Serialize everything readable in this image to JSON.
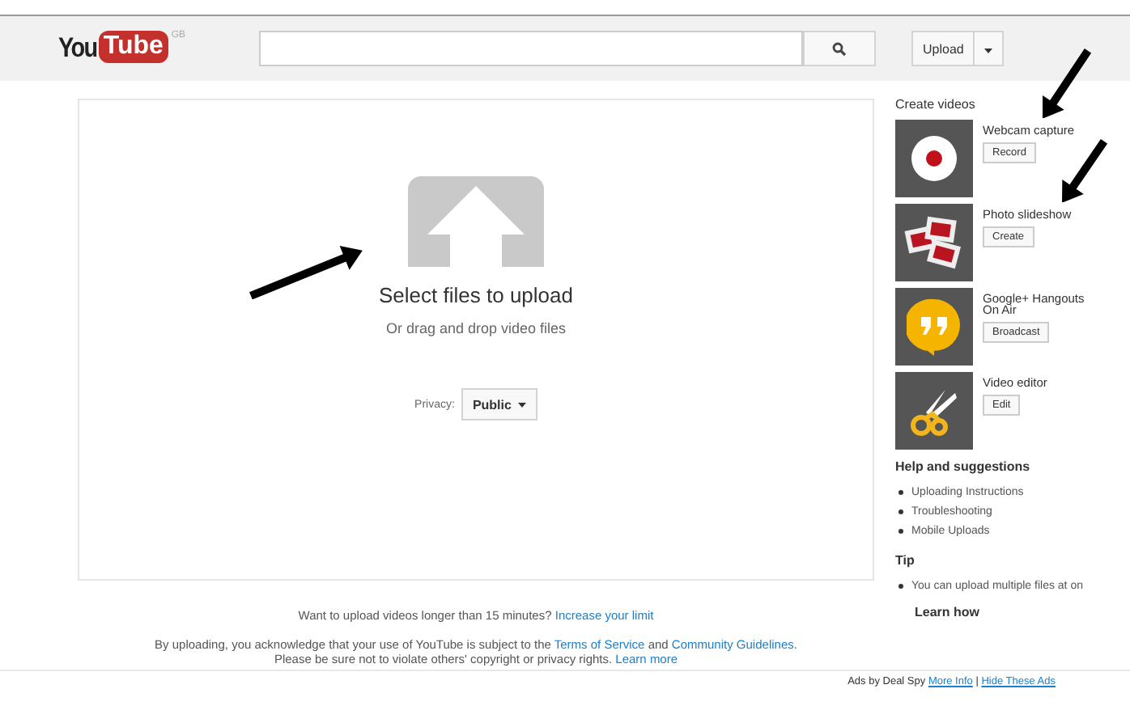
{
  "header": {
    "logo": {
      "you": "You",
      "tube": "Tube",
      "region": "GB"
    },
    "upload_button": "Upload"
  },
  "upload": {
    "title": "Select files to upload",
    "subtitle": "Or drag and drop video files",
    "privacy_label": "Privacy:",
    "privacy_value": "Public"
  },
  "limit_note": {
    "text": "Want to upload videos longer than 15 minutes? ",
    "link": "Increase your limit"
  },
  "terms": [
    [
      {
        "kind": "text",
        "text": "By uploading, you acknowledge that your use of YouTube is subject to the "
      },
      {
        "kind": "link",
        "text": "Terms of Service"
      },
      {
        "kind": "text",
        "text": " and "
      },
      {
        "kind": "link",
        "text": "Community Guidelines"
      },
      {
        "kind": "text",
        "text": "."
      }
    ],
    [
      {
        "kind": "text",
        "text": "Please be sure not to violate others' copyright or privacy rights. "
      },
      {
        "kind": "link",
        "text": "Learn more"
      }
    ]
  ],
  "sidebar": {
    "title": "Create videos",
    "items": [
      {
        "label": "Webcam capture",
        "button": "Record"
      },
      {
        "label": "Photo slideshow",
        "button": "Create"
      },
      {
        "label": "Google+ Hangouts On Air",
        "button": "Broadcast"
      },
      {
        "label": "Video editor",
        "button": "Edit"
      }
    ],
    "help_title": "Help and suggestions",
    "help_links": [
      "Uploading Instructions",
      "Troubleshooting",
      "Mobile Uploads"
    ],
    "tip_title": "Tip",
    "tips": [
      "You can upload multiple files at on"
    ],
    "tip_link": "Learn how"
  },
  "ads": [
    {
      "kind": "text",
      "text": "Ads by Deal Spy "
    },
    {
      "kind": "link",
      "text": "More Info"
    },
    {
      "kind": "text",
      "text": " | "
    },
    {
      "kind": "link",
      "text": "Hide These Ads"
    }
  ]
}
